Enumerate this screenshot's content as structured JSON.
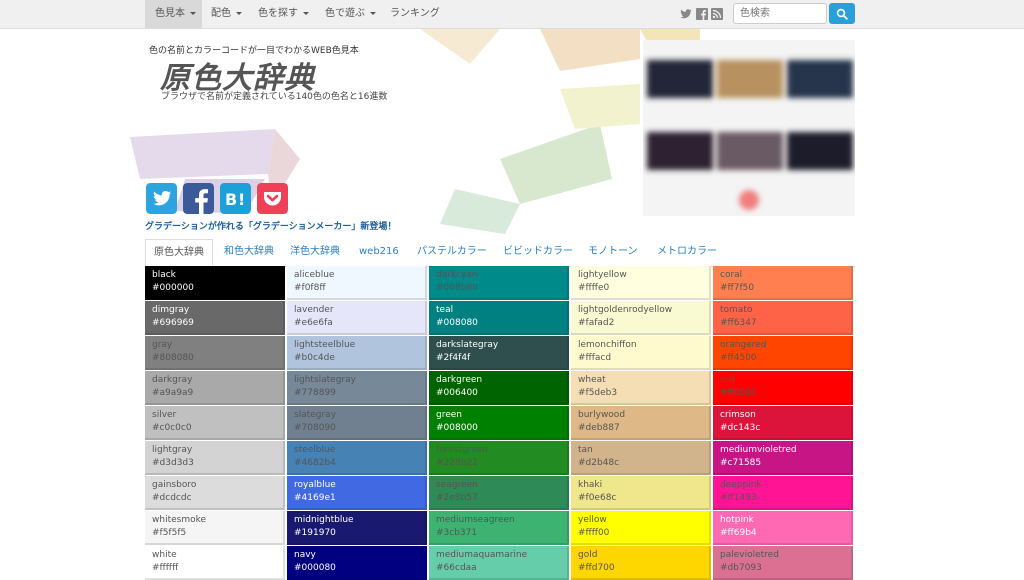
{
  "nav": {
    "items": [
      {
        "label": "色見本",
        "dropdown": true,
        "active": true
      },
      {
        "label": "配色",
        "dropdown": true,
        "active": false
      },
      {
        "label": "色を探す",
        "dropdown": true,
        "active": false
      },
      {
        "label": "色で遊ぶ",
        "dropdown": true,
        "active": false
      },
      {
        "label": "ランキング",
        "dropdown": false,
        "active": false
      }
    ],
    "social_icons": [
      "twitter-icon",
      "facebook-icon",
      "rss-icon"
    ],
    "search_placeholder": "色検索",
    "search_icon": "search-icon"
  },
  "header": {
    "subtitle": "色の名前とカラーコードが一目でわかるWEB色見本",
    "logo": "原色大辞典",
    "tagline": "ブラウザで名前が定義されている140色の色名と16進数"
  },
  "share_buttons": [
    "twitter-share-icon",
    "facebook-share-icon",
    "hatena-bookmark-icon",
    "pocket-icon"
  ],
  "announcement": "グラデーションが作れる「グラデーションメーカー」新登場！",
  "tabs": [
    "原色大辞典",
    "和色大辞典",
    "洋色大辞典",
    "web216",
    "パステルカラー",
    "ビビッドカラー",
    "モノトーン",
    "メトロカラー"
  ],
  "active_tab": 0,
  "colors": {
    "columns": [
      [
        {
          "name": "black",
          "code": "#000000",
          "fg": "#ffffff"
        },
        {
          "name": "dimgray",
          "code": "#696969",
          "fg": "#ffffff"
        },
        {
          "name": "gray",
          "code": "#808080",
          "fg": "#555555"
        },
        {
          "name": "darkgray",
          "code": "#a9a9a9",
          "fg": "#555555"
        },
        {
          "name": "silver",
          "code": "#c0c0c0",
          "fg": "#555555"
        },
        {
          "name": "lightgray",
          "code": "#d3d3d3",
          "fg": "#555555"
        },
        {
          "name": "gainsboro",
          "code": "#dcdcdc",
          "fg": "#555555"
        },
        {
          "name": "whitesmoke",
          "code": "#f5f5f5",
          "fg": "#555555"
        },
        {
          "name": "white",
          "code": "#ffffff",
          "fg": "#555555"
        }
      ],
      [
        {
          "name": "aliceblue",
          "code": "#f0f8ff",
          "fg": "#555555"
        },
        {
          "name": "lavender",
          "code": "#e6e6fa",
          "fg": "#555555"
        },
        {
          "name": "lightsteelblue",
          "code": "#b0c4de",
          "fg": "#555555"
        },
        {
          "name": "lightslategray",
          "code": "#778899",
          "fg": "#555555"
        },
        {
          "name": "slategray",
          "code": "#708090",
          "fg": "#555555"
        },
        {
          "name": "steelblue",
          "code": "#4682b4",
          "fg": "#555555"
        },
        {
          "name": "royalblue",
          "code": "#4169e1",
          "fg": "#ffffff"
        },
        {
          "name": "midnightblue",
          "code": "#191970",
          "fg": "#ffffff"
        },
        {
          "name": "navy",
          "code": "#000080",
          "fg": "#ffffff"
        }
      ],
      [
        {
          "name": "darkcyan",
          "code": "#008b8b",
          "fg": "#555555"
        },
        {
          "name": "teal",
          "code": "#008080",
          "fg": "#ffffff"
        },
        {
          "name": "darkslategray",
          "code": "#2f4f4f",
          "fg": "#ffffff"
        },
        {
          "name": "darkgreen",
          "code": "#006400",
          "fg": "#ffffff"
        },
        {
          "name": "green",
          "code": "#008000",
          "fg": "#ffffff"
        },
        {
          "name": "forestgreen",
          "code": "#228b22",
          "fg": "#555555"
        },
        {
          "name": "seagreen",
          "code": "#2e8b57",
          "fg": "#555555"
        },
        {
          "name": "mediumseagreen",
          "code": "#3cb371",
          "fg": "#555555"
        },
        {
          "name": "mediumaquamarine",
          "code": "#66cdaa",
          "fg": "#555555"
        }
      ],
      [
        {
          "name": "lightyellow",
          "code": "#ffffe0",
          "fg": "#555555"
        },
        {
          "name": "lightgoldenrodyellow",
          "code": "#fafad2",
          "fg": "#555555"
        },
        {
          "name": "lemonchiffon",
          "code": "#fffacd",
          "fg": "#555555"
        },
        {
          "name": "wheat",
          "code": "#f5deb3",
          "fg": "#555555"
        },
        {
          "name": "burlywood",
          "code": "#deb887",
          "fg": "#555555"
        },
        {
          "name": "tan",
          "code": "#d2b48c",
          "fg": "#555555"
        },
        {
          "name": "khaki",
          "code": "#f0e68c",
          "fg": "#555555"
        },
        {
          "name": "yellow",
          "code": "#ffff00",
          "fg": "#555555"
        },
        {
          "name": "gold",
          "code": "#ffd700",
          "fg": "#555555"
        }
      ],
      [
        {
          "name": "coral",
          "code": "#ff7f50",
          "fg": "#555555"
        },
        {
          "name": "tomato",
          "code": "#ff6347",
          "fg": "#555555"
        },
        {
          "name": "orangered",
          "code": "#ff4500",
          "fg": "#555555"
        },
        {
          "name": "red",
          "code": "#ff0000",
          "fg": "#555555"
        },
        {
          "name": "crimson",
          "code": "#dc143c",
          "fg": "#ffffff"
        },
        {
          "name": "mediumvioletred",
          "code": "#c71585",
          "fg": "#ffffff"
        },
        {
          "name": "deeppink",
          "code": "#ff1493",
          "fg": "#555555"
        },
        {
          "name": "hotpink",
          "code": "#ff69b4",
          "fg": "#ffffff"
        },
        {
          "name": "palevioletred",
          "code": "#db7093",
          "fg": "#555555"
        }
      ]
    ]
  }
}
